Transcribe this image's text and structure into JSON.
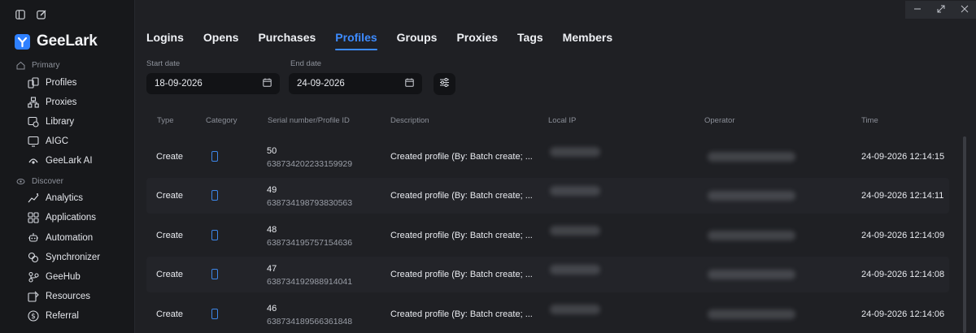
{
  "sidebar": {
    "brand": "GeeLark",
    "sections": [
      {
        "label": "Primary"
      },
      {
        "label": "Discover"
      }
    ],
    "primary_items": [
      {
        "label": "Profiles",
        "icon": "profiles-icon"
      },
      {
        "label": "Proxies",
        "icon": "proxies-icon"
      },
      {
        "label": "Library",
        "icon": "library-icon"
      },
      {
        "label": "AIGC",
        "icon": "aigc-icon"
      },
      {
        "label": "GeeLark AI",
        "icon": "geelark-ai-icon"
      }
    ],
    "discover_items": [
      {
        "label": "Analytics",
        "icon": "analytics-icon"
      },
      {
        "label": "Applications",
        "icon": "applications-icon"
      },
      {
        "label": "Automation",
        "icon": "automation-icon"
      },
      {
        "label": "Synchronizer",
        "icon": "synchronizer-icon"
      },
      {
        "label": "GeeHub",
        "icon": "geehub-icon"
      },
      {
        "label": "Resources",
        "icon": "resources-icon"
      },
      {
        "label": "Referral",
        "icon": "referral-icon"
      }
    ]
  },
  "tabs": [
    "Logins",
    "Opens",
    "Purchases",
    "Profiles",
    "Groups",
    "Proxies",
    "Tags",
    "Members"
  ],
  "active_tab": "Profiles",
  "filters": {
    "start_label": "Start date",
    "start_value": "18-09-2026",
    "end_label": "End date",
    "end_value": "24-09-2026"
  },
  "table": {
    "headers": [
      "Type",
      "Category",
      "Serial number/Profile ID",
      "Description",
      "Local IP",
      "Operator",
      "Time"
    ],
    "rows": [
      {
        "type": "Create",
        "serial": "50",
        "profile_id": "638734202233159929",
        "description": "Created profile (By: Batch create; ...",
        "time": "24-09-2026 12:14:15"
      },
      {
        "type": "Create",
        "serial": "49",
        "profile_id": "638734198793830563",
        "description": "Created profile (By: Batch create; ...",
        "time": "24-09-2026 12:14:11"
      },
      {
        "type": "Create",
        "serial": "48",
        "profile_id": "638734195757154636",
        "description": "Created profile (By: Batch create; ...",
        "time": "24-09-2026 12:14:09"
      },
      {
        "type": "Create",
        "serial": "47",
        "profile_id": "638734192988914041",
        "description": "Created profile (By: Batch create; ...",
        "time": "24-09-2026 12:14:08"
      },
      {
        "type": "Create",
        "serial": "46",
        "profile_id": "638734189566361848",
        "description": "Created profile (By: Batch create; ...",
        "time": "24-09-2026 12:14:06"
      }
    ]
  },
  "colors": {
    "accent": "#3d8bff",
    "background": "#1f2024",
    "sidebar": "#17181b"
  }
}
